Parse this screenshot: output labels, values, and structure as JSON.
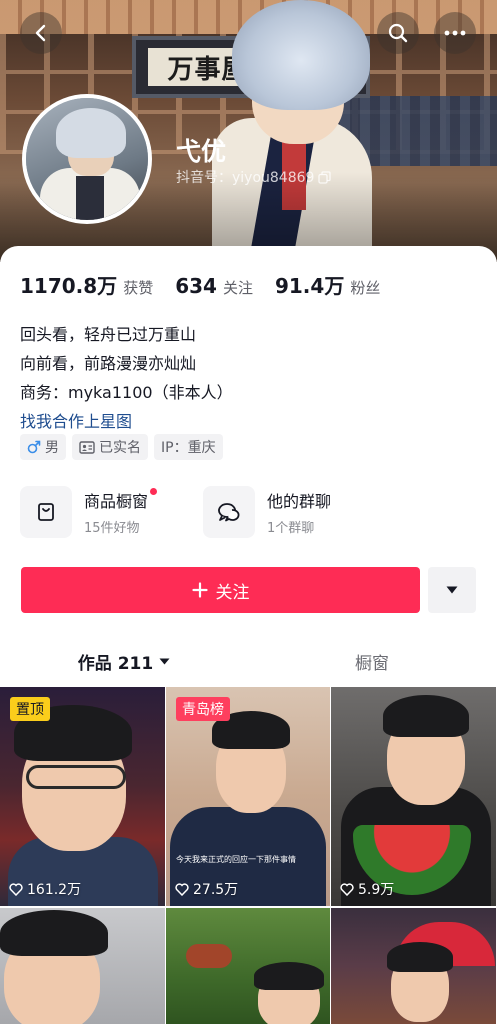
{
  "header": {
    "banner_sign_text": "万事屋",
    "back_icon": "back-arrow-icon",
    "search_icon": "search-icon",
    "more_icon": "more-dots-icon"
  },
  "profile": {
    "nickname": "弋优",
    "douyin_id": "抖音号：yiyou84869",
    "copy_icon": "copy-icon"
  },
  "stats": [
    {
      "value": "1170.8万",
      "label": "获赞"
    },
    {
      "value": "634",
      "label": "关注"
    },
    {
      "value": "91.4万",
      "label": "粉丝"
    }
  ],
  "bio": {
    "line1": "回头看，轻舟已过万重山",
    "line2": "向前看，前路漫漫亦灿灿",
    "line3": "商务：myka1100（非本人）",
    "link": "找我合作上星图"
  },
  "tags": [
    {
      "icon": "male-icon",
      "text": "男"
    },
    {
      "icon": "id-card-icon",
      "text": "已实名"
    },
    {
      "icon": "",
      "text": "IP：重庆"
    }
  ],
  "entries": [
    {
      "icon": "shop-bag-icon",
      "title": "商品橱窗",
      "sub": "15件好物",
      "dot": true
    },
    {
      "icon": "group-chat-icon",
      "title": "他的群聊",
      "sub": "1个群聊",
      "dot": false
    }
  ],
  "actions": {
    "follow_label": "关注",
    "more_icon": "caret-down-icon"
  },
  "tabs": {
    "works_label": "作品 211",
    "showcase_label": "橱窗"
  },
  "videos": [
    {
      "likes": "161.2万",
      "badge": "置顶",
      "caption": ""
    },
    {
      "likes": "27.5万",
      "badge": "青岛榜",
      "caption": "今天我来正式的回应一下那件事情"
    },
    {
      "likes": "5.9万",
      "badge": "",
      "caption": ""
    },
    {
      "likes": "",
      "badge": "",
      "caption": ""
    },
    {
      "likes": "",
      "badge": "",
      "caption": ""
    },
    {
      "likes": "",
      "badge": "",
      "caption": ""
    }
  ],
  "colors": {
    "accent": "#fe2c55",
    "link": "#1f4d8f",
    "pin_badge": "#facd1b",
    "rank_badge": "#fe3f5e"
  }
}
